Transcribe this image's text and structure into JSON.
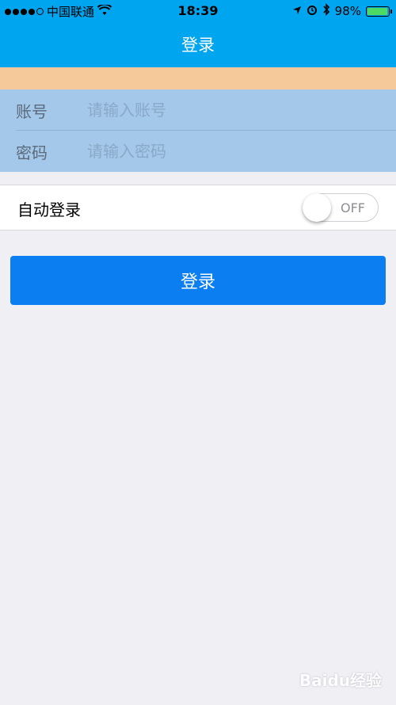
{
  "status_bar": {
    "carrier": "中国联通",
    "time": "18:39",
    "battery_percent": "98%",
    "battery_level": 0.98,
    "battery_color": "#4cd964"
  },
  "nav": {
    "title": "登录",
    "background": "#00a5ef"
  },
  "form": {
    "account": {
      "label": "账号",
      "placeholder": "请输入账号",
      "value": ""
    },
    "password": {
      "label": "密码",
      "placeholder": "请输入密码",
      "value": ""
    }
  },
  "auto_login": {
    "label": "自动登录",
    "toggle_text": "OFF",
    "on": false
  },
  "login_button": {
    "label": "登录",
    "color": "#0b7ff2"
  },
  "watermark": {
    "text": "Baidu经验"
  }
}
